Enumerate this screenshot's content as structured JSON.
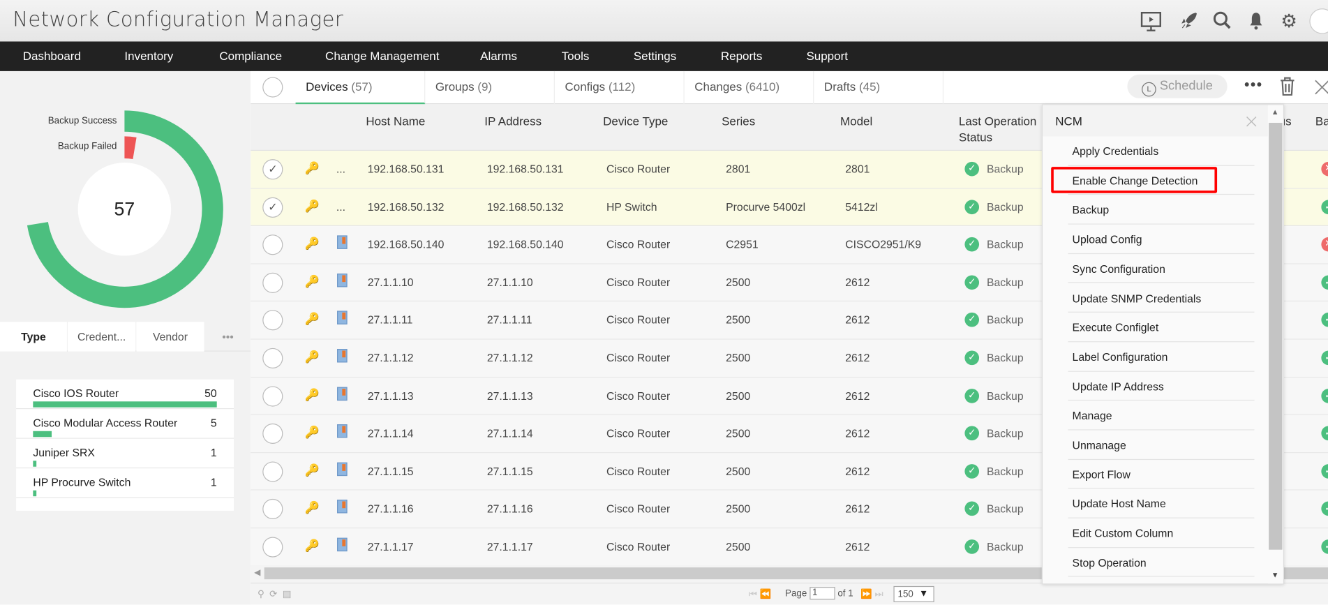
{
  "app": {
    "title": "Network Configuration Manager",
    "toolbar_icons": [
      "presentation-icon",
      "rocket-icon",
      "search-icon",
      "bell-icon",
      "gear-icon",
      "avatar-icon"
    ]
  },
  "nav": [
    "Dashboard",
    "Inventory",
    "Compliance",
    "Change Management",
    "Alarms",
    "Tools",
    "Settings",
    "Reports",
    "Support"
  ],
  "summary": {
    "total": "57",
    "legend": [
      "Backup Success",
      "Backup Failed"
    ],
    "colors": {
      "success": "#4cbf7f",
      "failed": "#ee5555"
    },
    "success": 55,
    "failed": 2
  },
  "left_tabs": [
    "Type",
    "Credent...",
    "Vendor",
    "•••"
  ],
  "type_list": [
    {
      "name": "Cisco IOS Router",
      "count": "50",
      "value": 50
    },
    {
      "name": "Cisco Modular Access Router",
      "count": "5",
      "value": 5
    },
    {
      "name": "Juniper SRX",
      "count": "1",
      "value": 1
    },
    {
      "name": "HP Procurve Switch",
      "count": "1",
      "value": 1
    }
  ],
  "tabs": [
    {
      "label": "Devices",
      "count": "(57)",
      "active": true
    },
    {
      "label": "Groups",
      "count": "(9)"
    },
    {
      "label": "Configs",
      "count": "(112)"
    },
    {
      "label": "Changes",
      "count": "(6410)"
    },
    {
      "label": "Drafts",
      "count": "(45)"
    }
  ],
  "schedule_label": "Schedule",
  "columns": [
    "Host Name",
    "IP Address",
    "Device Type",
    "Series",
    "Model",
    "Last Operation Status",
    "us",
    "Ba"
  ],
  "rows": [
    {
      "host": "192.168.50.131",
      "ip": "192.168.50.131",
      "type": "Cisco Router",
      "series": "2801",
      "model": "2801",
      "status": "Backup",
      "selected": true,
      "extra": "...",
      "last": "error"
    },
    {
      "host": "192.168.50.132",
      "ip": "192.168.50.132",
      "type": "HP Switch",
      "series": "Procurve 5400zl",
      "model": "5412zl",
      "status": "Backup",
      "selected": true,
      "extra": "...",
      "last": "ok"
    },
    {
      "host": "192.168.50.140",
      "ip": "192.168.50.140",
      "type": "Cisco Router",
      "series": "C2951",
      "model": "CISCO2951/K9",
      "status": "Backup",
      "last": "error"
    },
    {
      "host": "27.1.1.10",
      "ip": "27.1.1.10",
      "type": "Cisco Router",
      "series": "2500",
      "model": "2612",
      "status": "Backup",
      "last": "ok"
    },
    {
      "host": "27.1.1.11",
      "ip": "27.1.1.11",
      "type": "Cisco Router",
      "series": "2500",
      "model": "2612",
      "status": "Backup",
      "last": "ok"
    },
    {
      "host": "27.1.1.12",
      "ip": "27.1.1.12",
      "type": "Cisco Router",
      "series": "2500",
      "model": "2612",
      "status": "Backup",
      "last": "ok"
    },
    {
      "host": "27.1.1.13",
      "ip": "27.1.1.13",
      "type": "Cisco Router",
      "series": "2500",
      "model": "2612",
      "status": "Backup",
      "last": "ok"
    },
    {
      "host": "27.1.1.14",
      "ip": "27.1.1.14",
      "type": "Cisco Router",
      "series": "2500",
      "model": "2612",
      "status": "Backup",
      "last": "ok"
    },
    {
      "host": "27.1.1.15",
      "ip": "27.1.1.15",
      "type": "Cisco Router",
      "series": "2500",
      "model": "2612",
      "status": "Backup",
      "last": "ok"
    },
    {
      "host": "27.1.1.16",
      "ip": "27.1.1.16",
      "type": "Cisco Router",
      "series": "2500",
      "model": "2612",
      "status": "Backup",
      "last": "ok"
    },
    {
      "host": "27.1.1.17",
      "ip": "27.1.1.17",
      "type": "Cisco Router",
      "series": "2500",
      "model": "2612",
      "status": "Backup",
      "last": "ok"
    }
  ],
  "pager": {
    "page_label": "Page",
    "page": "1",
    "of_label": "of 1",
    "page_size": "150"
  },
  "menu": {
    "title": "NCM",
    "highlighted": "Enable Change Detection",
    "items": [
      "Apply Credentials",
      "Enable Change Detection",
      "Backup",
      "Upload Config",
      "Sync Configuration",
      "Update SNMP Credentials",
      "Execute Configlet",
      "Label Configuration",
      "Update IP Address",
      "Manage",
      "Unmanage",
      "Export Flow",
      "Update Host Name",
      "Edit Custom Column",
      "Stop Operation"
    ]
  }
}
